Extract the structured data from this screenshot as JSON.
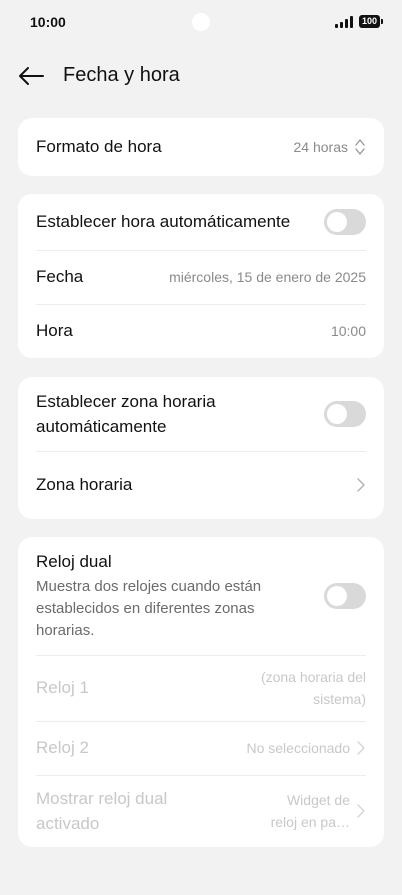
{
  "status": {
    "time": "10:00",
    "battery": "100"
  },
  "header": {
    "title": "Fecha y hora"
  },
  "format": {
    "label": "Formato de hora",
    "value": "24 horas"
  },
  "auto_time": {
    "label": "Establecer hora automáticamente",
    "enabled": false
  },
  "date": {
    "label": "Fecha",
    "value": "miércoles, 15 de enero de 2025"
  },
  "time": {
    "label": "Hora",
    "value": "10:00"
  },
  "auto_zone": {
    "label_line1": "Establecer zona horaria",
    "label_line2": "automáticamente",
    "enabled": false
  },
  "zone": {
    "label": "Zona horaria"
  },
  "dual": {
    "title": "Reloj dual",
    "desc_line1": "Muestra dos relojes cuando están",
    "desc_line2": "establecidos en diferentes zonas",
    "desc_line3": "horarias.",
    "enabled": false
  },
  "clock1": {
    "label": "Reloj 1",
    "value_line1": "(zona horaria del",
    "value_line2": "sistema)"
  },
  "clock2": {
    "label": "Reloj 2",
    "value": "No seleccionado"
  },
  "show_dual": {
    "label_line1": "Mostrar reloj dual",
    "label_line2": "activado",
    "value_line1": "Widget de",
    "value_line2": "reloj en pa…"
  },
  "icons": [
    "back-arrow-icon",
    "up-down-chevron-icon",
    "chevron-right-icon",
    "signal-icon",
    "battery-icon"
  ]
}
